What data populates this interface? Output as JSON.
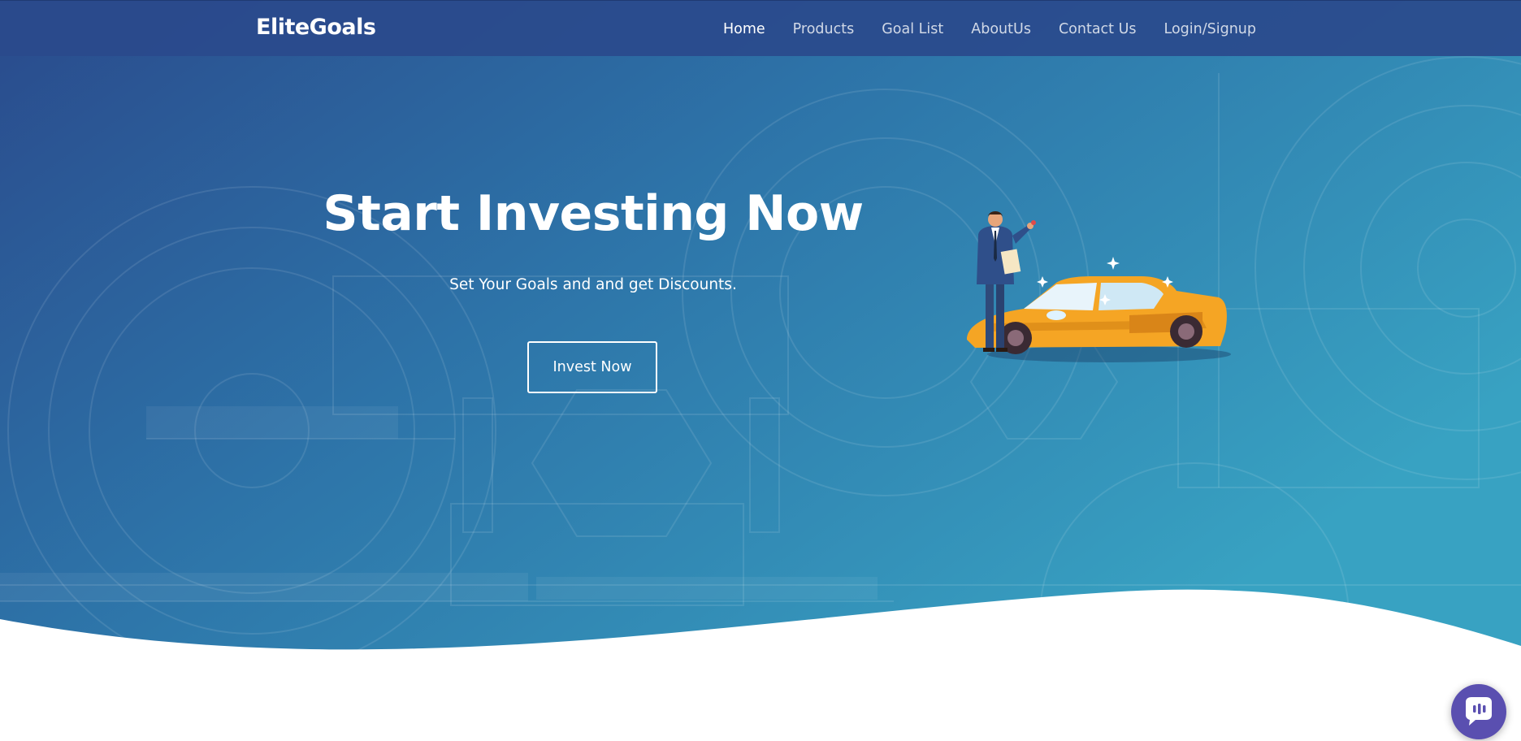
{
  "nav": {
    "brand": "EliteGoals",
    "links": [
      {
        "label": "Home",
        "active": true
      },
      {
        "label": "Products",
        "active": false
      },
      {
        "label": "Goal List",
        "active": false
      },
      {
        "label": "AboutUs",
        "active": false
      },
      {
        "label": "Contact Us",
        "active": false
      },
      {
        "label": "Login/Signup",
        "active": false
      }
    ]
  },
  "hero": {
    "title": "Start Investing Now",
    "subtitle": "Set Your Goals and and get Discounts.",
    "cta_label": "Invest Now",
    "illustration_icon": "man-with-sports-car-illustration"
  },
  "chat": {
    "icon": "chat-bubble-icon"
  },
  "colors": {
    "nav_bg": "#2a4a8c",
    "gradient_start": "#2a4a8c",
    "gradient_end": "#36a0c0",
    "car": "#f5a524",
    "chat": "#5a4fb0"
  }
}
